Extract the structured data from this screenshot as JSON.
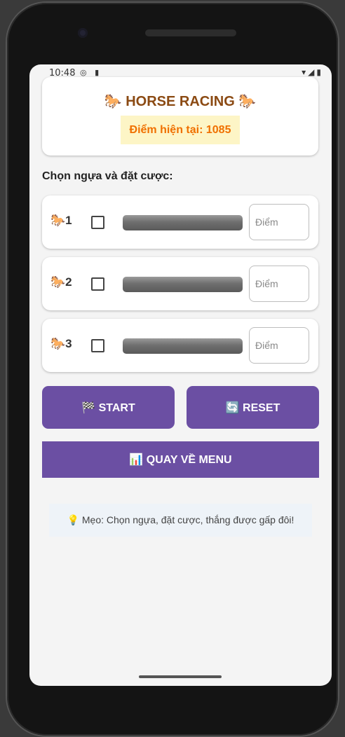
{
  "status_bar": {
    "time": "10:48",
    "left_icons": "◎ ▮",
    "right_icons": "▾◢▮"
  },
  "header": {
    "title": "🐎 HORSE RACING 🐎",
    "score": "Điểm hiện tại: 1085"
  },
  "section_label": "Chọn ngựa và đặt cược:",
  "horses": [
    {
      "label": "🐎1",
      "placeholder": "Điểm",
      "checked": false
    },
    {
      "label": "🐎2",
      "placeholder": "Điểm",
      "checked": false
    },
    {
      "label": "🐎3",
      "placeholder": "Điểm",
      "checked": false
    }
  ],
  "buttons": {
    "start": "🏁 START",
    "reset": "🔄 RESET",
    "menu": "📊 QUAY VỀ MENU"
  },
  "tip": "💡 Mẹo: Chọn ngựa, đặt cược, thắng được gấp đôi!",
  "colors": {
    "accent": "#6b4fa3",
    "title": "#8b4a13",
    "score_text": "#f07000",
    "score_bg": "#fdf5c6"
  }
}
